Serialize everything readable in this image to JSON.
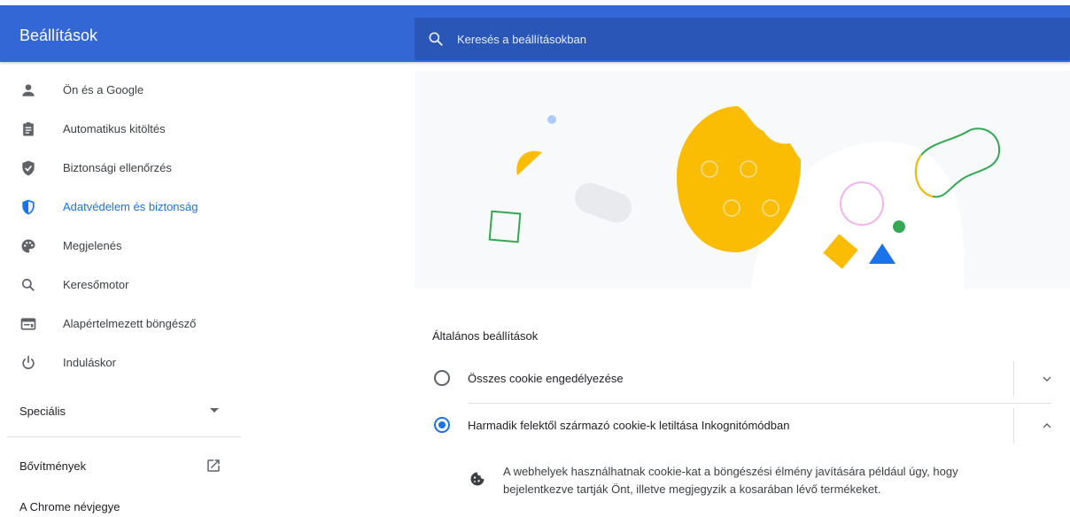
{
  "header": {
    "title": "Beállítások",
    "search_placeholder": "Keresés a beállításokban"
  },
  "sidebar": {
    "items": [
      {
        "label": "Ön és a Google",
        "icon": "person-icon"
      },
      {
        "label": "Automatikus kitöltés",
        "icon": "clipboard-icon"
      },
      {
        "label": "Biztonsági ellenőrzés",
        "icon": "shield-check-icon"
      },
      {
        "label": "Adatvédelem és biztonság",
        "icon": "shield-icon",
        "active": true
      },
      {
        "label": "Megjelenés",
        "icon": "palette-icon"
      },
      {
        "label": "Keresőmotor",
        "icon": "search-icon"
      },
      {
        "label": "Alapértelmezett böngésző",
        "icon": "browser-icon"
      },
      {
        "label": "Induláskor",
        "icon": "power-icon"
      }
    ],
    "special_label": "Speciális",
    "extensions_label": "Bővítmények",
    "about_label": "A Chrome névjegye"
  },
  "main": {
    "section_title": "Általános beállítások",
    "options": [
      {
        "label": "Összes cookie engedélyezése",
        "selected": false,
        "expanded": false
      },
      {
        "label": "Harmadik felektől származó cookie-k letiltása Inkognitómódban",
        "selected": true,
        "expanded": true
      }
    ],
    "description_line1": "A webhelyek használhatnak cookie-kat a böngészési élmény javítására például úgy, hogy",
    "description_line2": "bejelentkezve tartják Önt, illetve megjegyzik a kosarában lévő termékeket."
  },
  "colors": {
    "header_blue": "#3367d6",
    "search_blue": "#2a56b8",
    "accent": "#1a73e8",
    "cookie_yellow": "#fbbc04",
    "green": "#34a853"
  }
}
